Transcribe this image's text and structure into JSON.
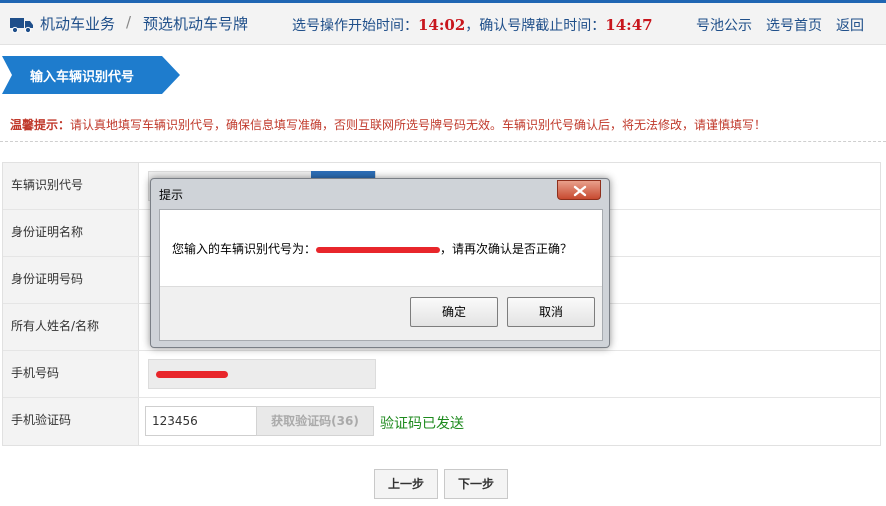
{
  "header": {
    "icon": "truck-icon",
    "crumb_1": "机动车业务",
    "separator": "/",
    "crumb_2": "预选机动车号牌",
    "start_label": "选号操作开始时间：",
    "start_time": "14:02",
    "deadline_label": "，确认号牌截止时间：",
    "deadline_time": "14:47",
    "links": [
      "号池公示",
      "选号首页",
      "返回"
    ]
  },
  "step": {
    "label": "输入车辆识别代号",
    "color": "#1e7ccd"
  },
  "tip": {
    "prefix": "温馨提示：",
    "text": "请认真地填写车辆识别代号，确保信息填写准确，否则互联网所选号牌号码无效。车辆识别代号确认后，将无法修改，请谨慎填写！"
  },
  "form": {
    "rows": [
      {
        "label": "车辆识别代号"
      },
      {
        "label": "身份证明名称"
      },
      {
        "label": "身份证明号码"
      },
      {
        "label": "所有人姓名/名称"
      },
      {
        "label": "手机号码"
      },
      {
        "label": "手机验证码"
      }
    ],
    "code_value": "123456",
    "code_button": "获取验证码(36)",
    "sent_text": "验证码已发送"
  },
  "buttons": {
    "prev": "上一步",
    "next": "下一步"
  },
  "dialog": {
    "title": "提示",
    "close_icon": "close-icon",
    "message_before": "您输入的车辆识别代号为：",
    "message_after": "，请再次确认是否正确？",
    "ok": "确定",
    "cancel": "取消"
  }
}
